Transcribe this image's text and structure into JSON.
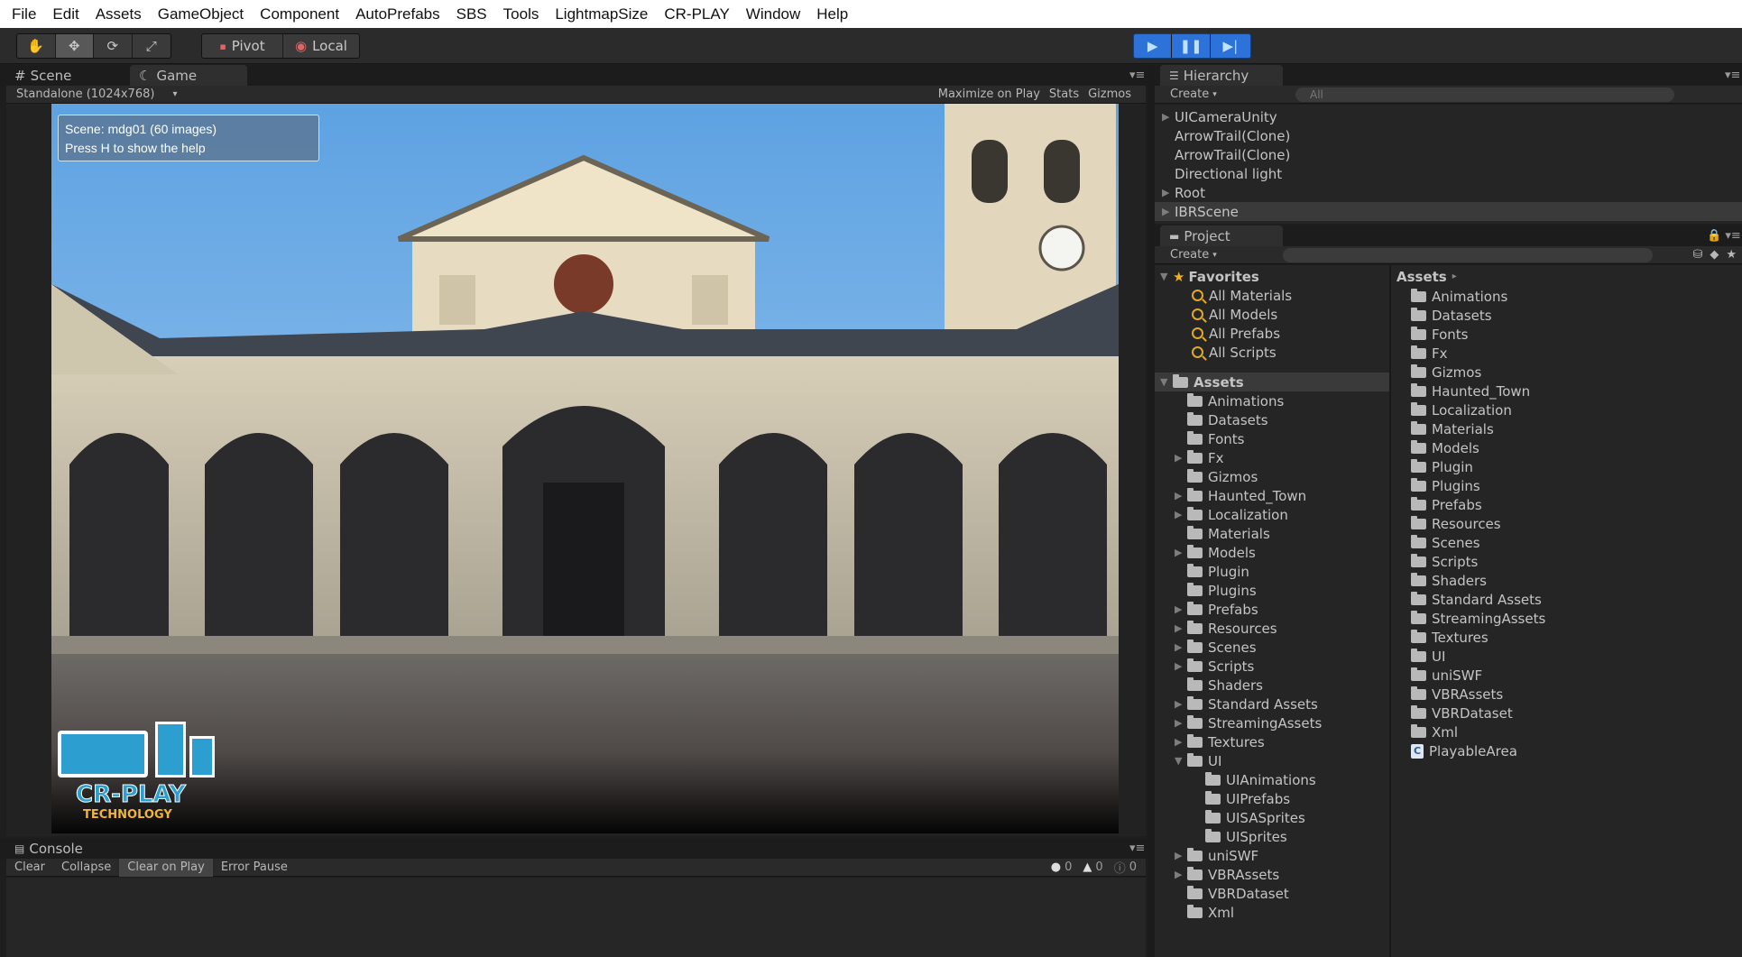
{
  "menu": [
    "File",
    "Edit",
    "Assets",
    "GameObject",
    "Component",
    "AutoPrefabs",
    "SBS",
    "Tools",
    "LightmapSize",
    "CR-PLAY",
    "Window",
    "Help"
  ],
  "toolbar": {
    "pivot_label": "Pivot",
    "local_label": "Local"
  },
  "scene_tab": "Scene",
  "game_tab": "Game",
  "game_bar": {
    "resolution": "Standalone (1024x768)",
    "maximize": "Maximize on Play",
    "stats": "Stats",
    "gizmos": "Gizmos"
  },
  "game_overlay": {
    "line1": "Scene: mdg01 (60 images)",
    "line2": "Press H to show the help",
    "logo_main": "CR-PLAY",
    "logo_sub": "TECHNOLOGY"
  },
  "hierarchy": {
    "tab": "Hierarchy",
    "create": "Create",
    "search_placeholder": "All",
    "items": [
      {
        "label": "UICameraUnity",
        "expandable": true
      },
      {
        "label": "ArrowTrail(Clone)",
        "expandable": false
      },
      {
        "label": "ArrowTrail(Clone)",
        "expandable": false
      },
      {
        "label": "Directional light",
        "expandable": false
      },
      {
        "label": "Root",
        "expandable": true
      },
      {
        "label": "IBRScene",
        "expandable": true
      }
    ]
  },
  "project": {
    "tab": "Project",
    "create": "Create",
    "favorites_label": "Favorites",
    "favorites": [
      "All Materials",
      "All Models",
      "All Prefabs",
      "All Scripts"
    ],
    "assets_label": "Assets",
    "tree": [
      {
        "label": "Animations",
        "expandable": false,
        "depth": 1
      },
      {
        "label": "Datasets",
        "expandable": false,
        "depth": 1
      },
      {
        "label": "Fonts",
        "expandable": false,
        "depth": 1
      },
      {
        "label": "Fx",
        "expandable": true,
        "depth": 1
      },
      {
        "label": "Gizmos",
        "expandable": false,
        "depth": 1
      },
      {
        "label": "Haunted_Town",
        "expandable": true,
        "depth": 1
      },
      {
        "label": "Localization",
        "expandable": true,
        "depth": 1
      },
      {
        "label": "Materials",
        "expandable": false,
        "depth": 1
      },
      {
        "label": "Models",
        "expandable": true,
        "depth": 1
      },
      {
        "label": "Plugin",
        "expandable": false,
        "depth": 1
      },
      {
        "label": "Plugins",
        "expandable": false,
        "depth": 1
      },
      {
        "label": "Prefabs",
        "expandable": true,
        "depth": 1
      },
      {
        "label": "Resources",
        "expandable": true,
        "depth": 1
      },
      {
        "label": "Scenes",
        "expandable": true,
        "depth": 1
      },
      {
        "label": "Scripts",
        "expandable": true,
        "depth": 1
      },
      {
        "label": "Shaders",
        "expandable": false,
        "depth": 1
      },
      {
        "label": "Standard Assets",
        "expandable": true,
        "depth": 1
      },
      {
        "label": "StreamingAssets",
        "expandable": true,
        "depth": 1
      },
      {
        "label": "Textures",
        "expandable": true,
        "depth": 1
      },
      {
        "label": "UI",
        "expandable": true,
        "expanded": true,
        "depth": 1
      },
      {
        "label": "UIAnimations",
        "expandable": false,
        "depth": 2
      },
      {
        "label": "UIPrefabs",
        "expandable": false,
        "depth": 2
      },
      {
        "label": "UISASprites",
        "expandable": false,
        "depth": 2
      },
      {
        "label": "UISprites",
        "expandable": false,
        "depth": 2
      },
      {
        "label": "uniSWF",
        "expandable": true,
        "depth": 1
      },
      {
        "label": "VBRAssets",
        "expandable": true,
        "depth": 1
      },
      {
        "label": "VBRDataset",
        "expandable": false,
        "depth": 1
      },
      {
        "label": "Xml",
        "expandable": false,
        "depth": 1
      }
    ],
    "breadcrumb": "Assets",
    "right_items": [
      "Animations",
      "Datasets",
      "Fonts",
      "Fx",
      "Gizmos",
      "Haunted_Town",
      "Localization",
      "Materials",
      "Models",
      "Plugin",
      "Plugins",
      "Prefabs",
      "Resources",
      "Scenes",
      "Scripts",
      "Shaders",
      "Standard Assets",
      "StreamingAssets",
      "Textures",
      "UI",
      "uniSWF",
      "VBRAssets",
      "VBRDataset",
      "Xml"
    ],
    "script_item": "PlayableArea"
  },
  "console": {
    "tab": "Console",
    "buttons": [
      "Clear",
      "Collapse",
      "Clear on Play",
      "Error Pause"
    ],
    "active_button": "Clear on Play",
    "errors": "0",
    "warnings": "0",
    "infos": "0"
  },
  "colors": {
    "play_blue": "#2d72d8",
    "folder_gray": "#b9b9b9",
    "favorite_star": "#f2b01e",
    "search_orange": "#e0a82a"
  }
}
